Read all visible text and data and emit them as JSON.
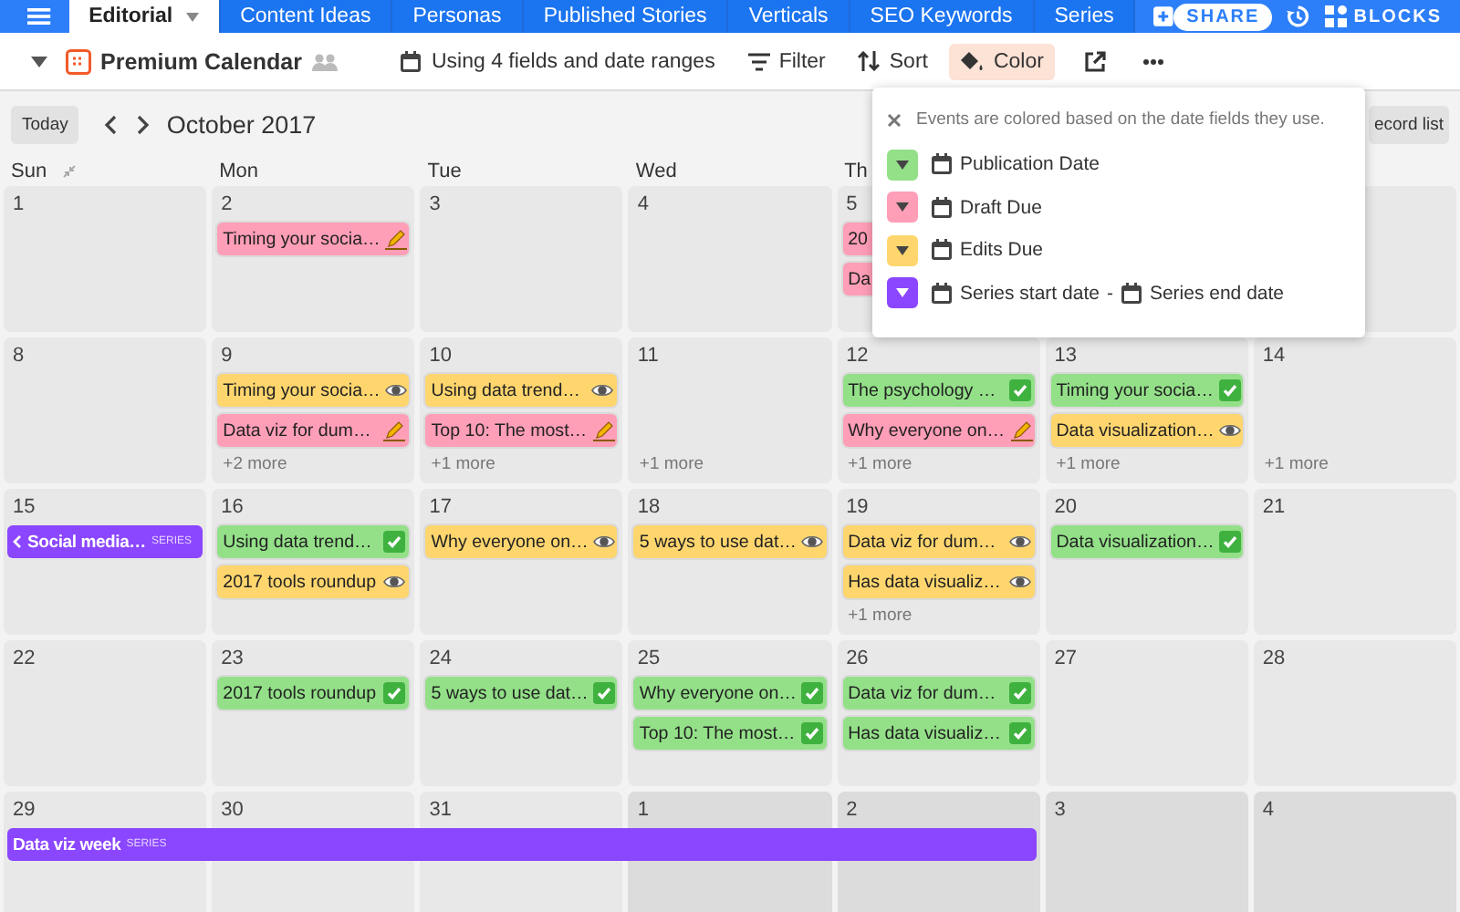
{
  "top_bar": {
    "tabs": [
      {
        "label": "Editorial",
        "selected": true
      },
      {
        "label": "Content Ideas",
        "selected": false
      },
      {
        "label": "Personas",
        "selected": false
      },
      {
        "label": "Published Stories",
        "selected": false
      },
      {
        "label": "Verticals",
        "selected": false
      },
      {
        "label": "SEO Keywords",
        "selected": false
      },
      {
        "label": "Series",
        "selected": false
      }
    ],
    "share": "SHARE",
    "blocks": "BLOCKS"
  },
  "view_bar": {
    "view_name": "Premium Calendar",
    "tools": [
      {
        "kind": "dates",
        "label": "Using 4 fields and date ranges",
        "selected": false
      },
      {
        "kind": "filter",
        "label": "Filter",
        "selected": false
      },
      {
        "kind": "sort",
        "label": "Sort",
        "selected": false
      },
      {
        "kind": "color",
        "label": "Color",
        "selected": true
      }
    ]
  },
  "calendar": {
    "today": "Today",
    "month": "October 2017",
    "record_list": "ecord list",
    "weekdays": [
      "Sun",
      "Mon",
      "Tue",
      "Wed",
      "Th"
    ],
    "weeks": [
      [
        {
          "day": "1"
        },
        {
          "day": "2",
          "events": [
            {
              "kind": "draft",
              "title": "Timing your socia…"
            }
          ]
        },
        {
          "day": "3"
        },
        {
          "day": "4"
        },
        {
          "day": "5",
          "events": [
            {
              "kind": "draft",
              "title": "20"
            },
            {
              "kind": "draft",
              "title": "Da"
            }
          ]
        }
      ],
      [
        {
          "day": "8"
        },
        {
          "day": "9",
          "events": [
            {
              "kind": "edits",
              "title": "Timing your socia…"
            },
            {
              "kind": "draft",
              "title": "Data viz for dum…"
            }
          ],
          "more": "+2 more"
        },
        {
          "day": "10",
          "events": [
            {
              "kind": "edits",
              "title": "Using data trend…"
            },
            {
              "kind": "draft",
              "title": "Top 10: The most…"
            }
          ],
          "more": "+1 more"
        },
        {
          "day": "11",
          "more": "+1 more"
        },
        {
          "day": "12",
          "events": [
            {
              "kind": "publication",
              "title": "The psychology …"
            },
            {
              "kind": "draft",
              "title": "Why everyone on…"
            }
          ],
          "more": "+1 more"
        },
        {
          "day": "13",
          "events": [
            {
              "kind": "publication",
              "title": "Timing your socia…"
            },
            {
              "kind": "edits",
              "title": "Data visualization…"
            }
          ],
          "more": "+1 more"
        },
        {
          "day": "14",
          "more": "+1 more"
        }
      ],
      [
        {
          "day": "15",
          "series": {
            "title": "Social media…",
            "tag": "SERIES",
            "continues_before": true
          }
        },
        {
          "day": "16",
          "events": [
            {
              "kind": "publication",
              "title": "Using data trend…"
            },
            {
              "kind": "edits",
              "title": "2017 tools roundup"
            }
          ]
        },
        {
          "day": "17",
          "events": [
            {
              "kind": "edits",
              "title": "Why everyone on…"
            }
          ]
        },
        {
          "day": "18",
          "events": [
            {
              "kind": "edits",
              "title": "5 ways to use dat…"
            }
          ]
        },
        {
          "day": "19",
          "events": [
            {
              "kind": "edits",
              "title": "Data viz for dum…"
            },
            {
              "kind": "edits",
              "title": "Has data visualiz…"
            }
          ],
          "more": "+1 more"
        },
        {
          "day": "20",
          "events": [
            {
              "kind": "publication",
              "title": "Data visualization…"
            }
          ]
        },
        {
          "day": "21"
        }
      ],
      [
        {
          "day": "22"
        },
        {
          "day": "23",
          "events": [
            {
              "kind": "publication",
              "title": "2017 tools roundup"
            }
          ]
        },
        {
          "day": "24",
          "events": [
            {
              "kind": "publication",
              "title": "5 ways to use dat…"
            }
          ]
        },
        {
          "day": "25",
          "events": [
            {
              "kind": "publication",
              "title": "Why everyone on…"
            },
            {
              "kind": "publication",
              "title": "Top 10: The most…"
            }
          ]
        },
        {
          "day": "26",
          "events": [
            {
              "kind": "publication",
              "title": "Data viz for dum…"
            },
            {
              "kind": "publication",
              "title": "Has data visualiz…"
            }
          ]
        },
        {
          "day": "27"
        },
        {
          "day": "28"
        }
      ],
      [
        {
          "day": "29",
          "series": {
            "title": "Data viz week",
            "tag": "SERIES",
            "continues_before": false
          }
        },
        {
          "day": "30",
          "series_continues": true
        },
        {
          "day": "31",
          "series_continues": true
        },
        {
          "day": "1",
          "outside": true,
          "series_continues": true
        },
        {
          "day": "2",
          "outside": true,
          "series_continues": true
        },
        {
          "day": "3",
          "outside": true
        },
        {
          "day": "4",
          "outside": true
        }
      ]
    ]
  },
  "color_popup": {
    "note": "Events are colored based on the date fields they use.",
    "legend": [
      {
        "color": "#93e088",
        "fields": [
          "Publication Date"
        ]
      },
      {
        "color": "#ff9eb7",
        "fields": [
          "Draft Due"
        ]
      },
      {
        "color": "#ffd66e",
        "fields": [
          "Edits Due"
        ]
      },
      {
        "color": "#8b46ff",
        "fields": [
          "Series start date",
          "Series end date"
        ],
        "joiner": "-"
      }
    ]
  }
}
